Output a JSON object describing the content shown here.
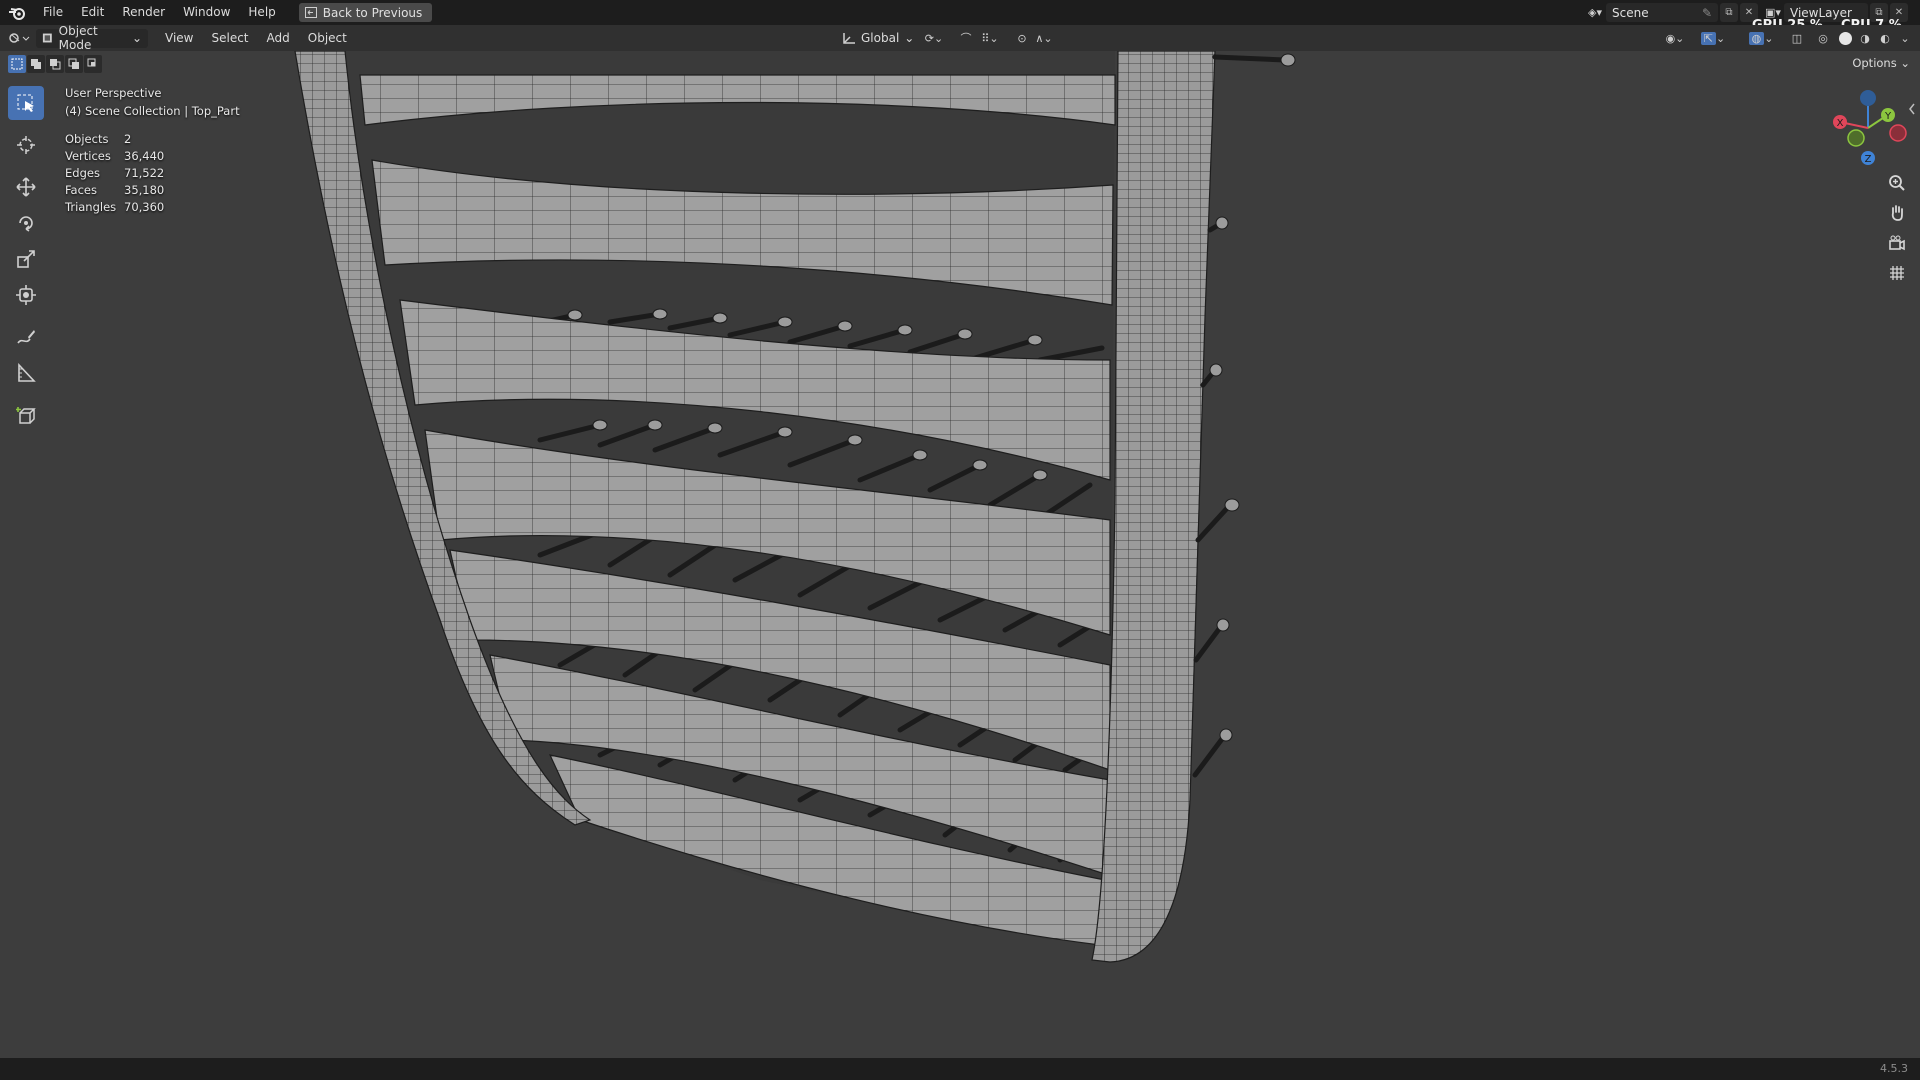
{
  "topbar": {
    "menus": [
      "File",
      "Edit",
      "Render",
      "Window",
      "Help"
    ],
    "back_button": "Back to Previous",
    "scene": "Scene",
    "view_layer": "ViewLayer",
    "gpu_label": "GPU",
    "gpu_value": "25 %",
    "cpu_label": "CPU",
    "cpu_value": "7 %"
  },
  "header": {
    "mode": "Object Mode",
    "menus": [
      "View",
      "Select",
      "Add",
      "Object"
    ],
    "transform_orientation": "Global"
  },
  "options_label": "Options",
  "overlay": {
    "view_name": "User Perspective",
    "collection": "(4) Scene Collection | Top_Part",
    "stats": [
      {
        "label": "Objects",
        "value": "2"
      },
      {
        "label": "Vertices",
        "value": "36,440"
      },
      {
        "label": "Edges",
        "value": "71,522"
      },
      {
        "label": "Faces",
        "value": "35,180"
      },
      {
        "label": "Triangles",
        "value": "70,360"
      }
    ]
  },
  "gizmo": {
    "x": "X",
    "y": "Y",
    "z": "Z"
  },
  "tools": [
    "select-box",
    "cursor",
    "move",
    "rotate",
    "scale",
    "transform",
    "annotate",
    "measure",
    "add-cube"
  ],
  "version": "4.5.3",
  "colors": {
    "accent": "#4772b3",
    "viewport_bg": "#3d3d3d",
    "mesh_face": "#a2a2a2",
    "axis_x": "#e0465a",
    "axis_y": "#8cc63f",
    "axis_z": "#3f83d6"
  }
}
